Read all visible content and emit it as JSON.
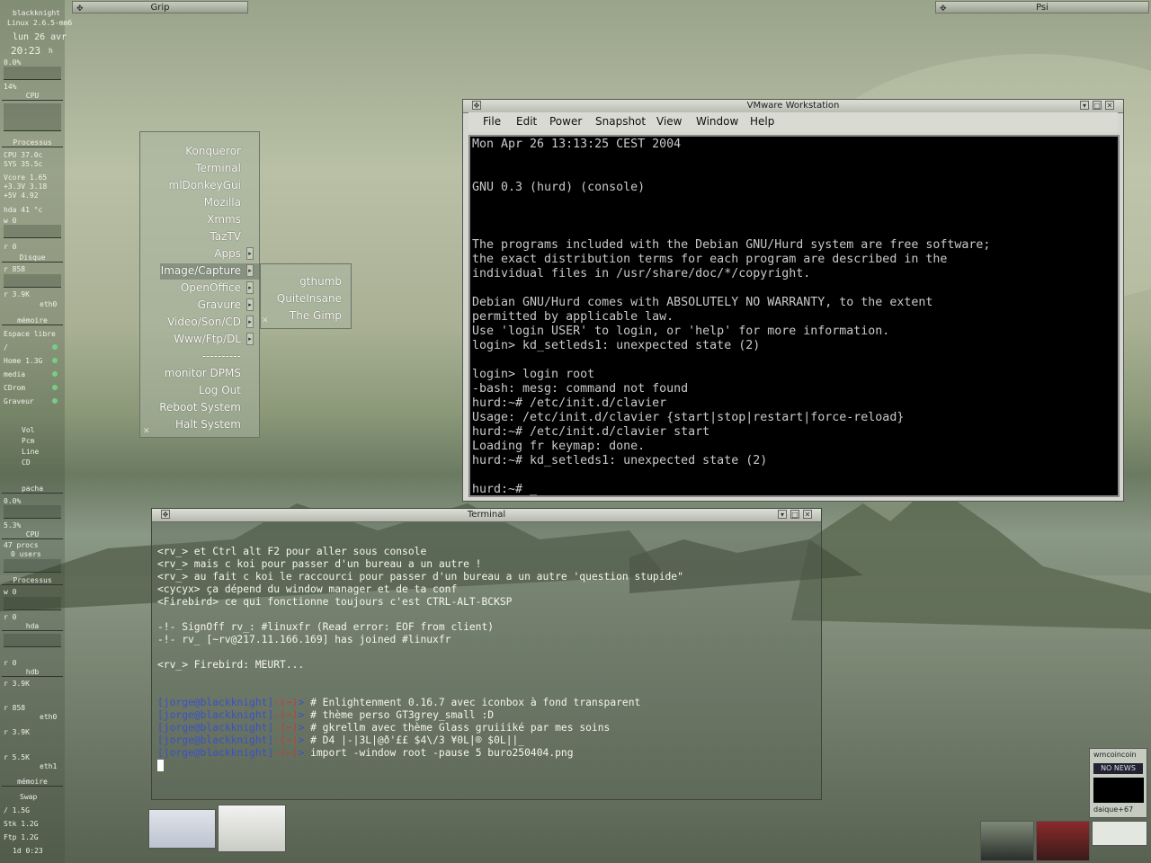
{
  "gkrellm": {
    "hostname": "blackknight",
    "kernel": "Linux 2.6.5-mm6",
    "date": "lun 26 avr",
    "time": "20:23",
    "time_suffix": "h",
    "cpu_top": "0.0%",
    "cpu_pct2": "14%",
    "cpu_label": "CPU",
    "processus_label": "Processus",
    "sensors": [
      "CPU  37.0c",
      "SYS  35.5c",
      "Vcore 1.65",
      "+3.3V 3.18",
      "+5V  4.92"
    ],
    "hda_temp": "hda 41 °c",
    "w0": "w 0",
    "r0": "r 0",
    "disque_label": "Disque",
    "disk_val": "r 858",
    "net_val": "r 3.9K",
    "eth0_label": "eth0",
    "memoire_label": "mémoire",
    "espace_libre": "Espace libre",
    "fs": [
      "/",
      "Home 1.3G",
      "media",
      "CDrom",
      "Graveur"
    ],
    "mixer": [
      "Vol",
      "Pcm",
      "Line",
      "CD"
    ],
    "pacha_label": "pacha",
    "cpu2_pct": "0.0%",
    "cpu2_pct_b": "5.3%",
    "cpu2_label": "CPU",
    "procs": "47 procs",
    "users": "0 users",
    "processus2_label": "Processus",
    "hda_label": "hda",
    "hdb_label": "hdb",
    "net2_val": "r 3.9K",
    "eth0b_label": "eth0",
    "net3_val": "r 3.9K",
    "net4_val": "r 5.5K",
    "eth1_label": "eth1",
    "memoire2_label": "mémoire",
    "swap_label": "Swap",
    "fs2": [
      "/ 1.5G",
      "Stk 1.2G",
      "Ftp 1.2G"
    ],
    "uptime": "1d   0:23"
  },
  "shaded_windows": {
    "grip_title": "Grip",
    "psi_title": "Psi"
  },
  "menu": {
    "items": [
      "Konqueror",
      "Terminal",
      "mlDonkeyGui",
      "Mozilla",
      "Xmms",
      "TazTV",
      "Apps",
      "Image/Capture",
      "OpenOffice",
      "Gravure",
      "Video/Son/CD",
      "Www/Ftp/DL",
      "----------",
      "monitor DPMS",
      "Log Out",
      "Reboot System",
      "Halt System"
    ],
    "submenu": [
      "gthumb",
      "QuiteInsane",
      "The Gimp"
    ]
  },
  "vmware": {
    "title": "VMware Workstation",
    "menus": [
      "File",
      "Edit",
      "Power",
      "Snapshot",
      "View",
      "Window",
      "Help"
    ],
    "console_lines": [
      "Mon Apr 26 13:13:25 CEST 2004",
      "",
      "",
      "GNU 0.3 (hurd) (console)",
      "",
      "",
      "",
      "The programs included with the Debian GNU/Hurd system are free software;",
      "the exact distribution terms for each program are described in the",
      "individual files in /usr/share/doc/*/copyright.",
      "",
      "Debian GNU/Hurd comes with ABSOLUTELY NO WARRANTY, to the extent",
      "permitted by applicable law.",
      "Use 'login USER' to login, or 'help' for more information.",
      "login> kd_setleds1: unexpected state (2)",
      "",
      "login> login root",
      "-bash: mesg: command not found",
      "hurd:~# /etc/init.d/clavier",
      "Usage: /etc/init.d/clavier {start|stop|restart|force-reload}",
      "hurd:~# /etc/init.d/clavier start",
      "Loading fr keymap: done.",
      "hurd:~# kd_setleds1: unexpected state (2)",
      "",
      "hurd:~# _"
    ]
  },
  "terminal": {
    "title": "Terminal",
    "lines": [
      "<rv_> et Ctrl alt F2 pour aller sous console",
      "<rv_> mais c koi pour passer d'un bureau a un autre !",
      "<rv_> au fait c koi le raccourci pour passer d'un bureau a un autre 'question stupide\"",
      "<cycyx> ça dépend du window manager et de ta conf",
      "<Firebird> ce qui fonctionne toujours c'est CTRL-ALT-BCKSP",
      "",
      "-!- SignOff rv_: #linuxfr (Read error: EOF from client)",
      "-!- rv_ [~rv@217.11.166.169] has joined #linuxfr",
      "",
      "<rv_> Firebird: MEURT..."
    ],
    "prompt_user": "[jorge@blackknight]",
    "prompt_dir": "-(~)",
    "prompt_arrow": "> ",
    "commands": [
      "# Enlightenment 0.16.7 avec iconbox à fond transparent",
      "# thème perso GT3grey_small :D",
      "# gkrellm avec thème Glass gruiiiké par mes soins",
      "# D4 |-|3L|@ð'££ $4\\/3 ¥0L|® $0L||_",
      "import -window root -pause 5 buro250404.png"
    ]
  },
  "wmcoincoin": {
    "title": "wmcoincoin",
    "news": "NO NEWS",
    "user": "daique+67"
  }
}
